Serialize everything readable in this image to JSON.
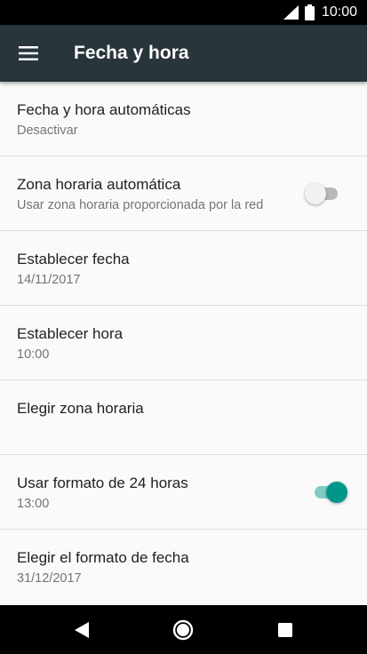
{
  "status_bar": {
    "time": "10:00",
    "icons": [
      "signal-icon",
      "battery-icon"
    ]
  },
  "app_bar": {
    "menu_icon": "hamburger-menu-icon",
    "title": "Fecha y hora",
    "background": "#28353b"
  },
  "settings": {
    "auto_datetime": {
      "label": "Fecha y hora automáticas",
      "summary": "Desactivar"
    },
    "auto_timezone": {
      "label": "Zona horaria automática",
      "summary": "Usar zona horaria proporcionada por la red",
      "toggle_on": false
    },
    "set_date": {
      "label": "Establecer fecha",
      "summary": "14/11/2017"
    },
    "set_time": {
      "label": "Establecer hora",
      "summary": "10:00"
    },
    "choose_timezone": {
      "label": "Elegir zona horaria"
    },
    "use_24h": {
      "label": "Usar formato de 24 horas",
      "summary": "13:00",
      "toggle_on": true
    },
    "date_format": {
      "label": "Elegir el formato de fecha",
      "summary": "31/12/2017"
    }
  },
  "nav_bar": {
    "buttons": [
      "back-icon",
      "home-icon",
      "recents-icon"
    ]
  },
  "colors": {
    "accent": "#009688",
    "accent_track": "#80cbc4",
    "background": "#fafafa",
    "primary_text": "#212121",
    "secondary_text": "#757575"
  }
}
